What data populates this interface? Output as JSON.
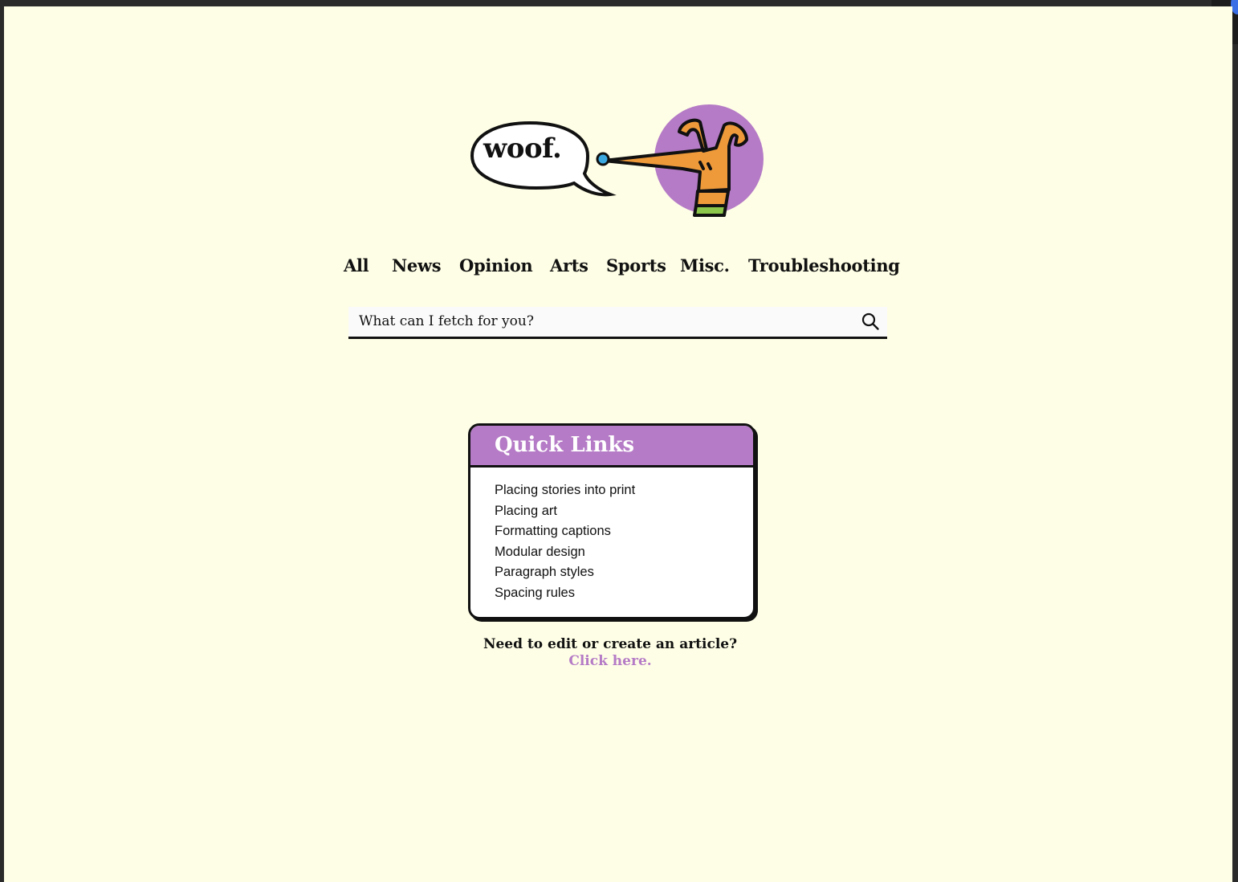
{
  "logo": {
    "bubble_text": "woof."
  },
  "nav": {
    "items": [
      {
        "label": "All"
      },
      {
        "label": "News"
      },
      {
        "label": "Opinion"
      },
      {
        "label": "Arts"
      },
      {
        "label": "Sports"
      },
      {
        "label": "Misc."
      },
      {
        "label": "Troubleshooting"
      }
    ]
  },
  "search": {
    "placeholder": "What can I fetch for you?",
    "icon": "search-icon"
  },
  "quick_links": {
    "title": "Quick Links",
    "items": [
      "Placing stories into print",
      "Placing art",
      "Formatting captions",
      "Modular design",
      "Paragraph styles",
      "Spacing rules"
    ]
  },
  "cta": {
    "question": "Need to edit or create an article?",
    "link_text": "Click here."
  },
  "colors": {
    "background": "#fefee6",
    "accent_purple": "#b57bc6",
    "dog_orange": "#ee9a3a",
    "collar_green": "#8cc64a",
    "nose_blue": "#3ba8e0"
  }
}
